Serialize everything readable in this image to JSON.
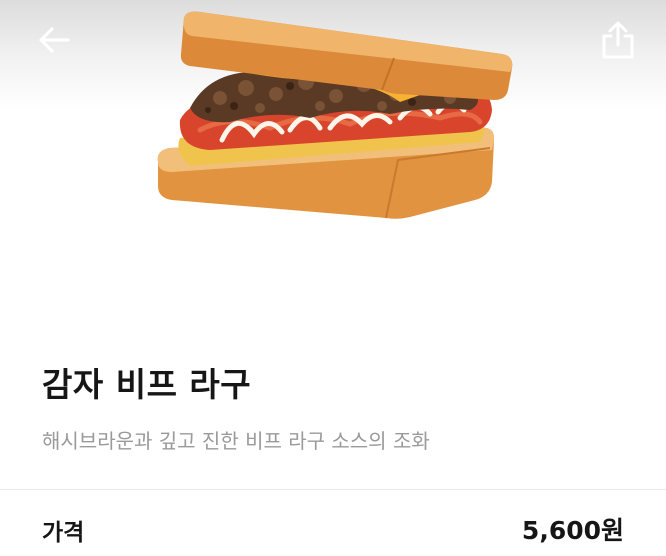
{
  "header": {
    "back_icon": "arrow-left-icon",
    "share_icon": "share-icon"
  },
  "product": {
    "image_icon": "sandwich-image",
    "name": "감자 비프 라구",
    "description": "해시브라운과 깊고 진한 비프 라구 소스의 조화"
  },
  "price": {
    "label": "가격",
    "value": "5,600원"
  },
  "colors": {
    "text": "#161616",
    "muted": "#9a9a9a",
    "divider": "#ececec"
  }
}
